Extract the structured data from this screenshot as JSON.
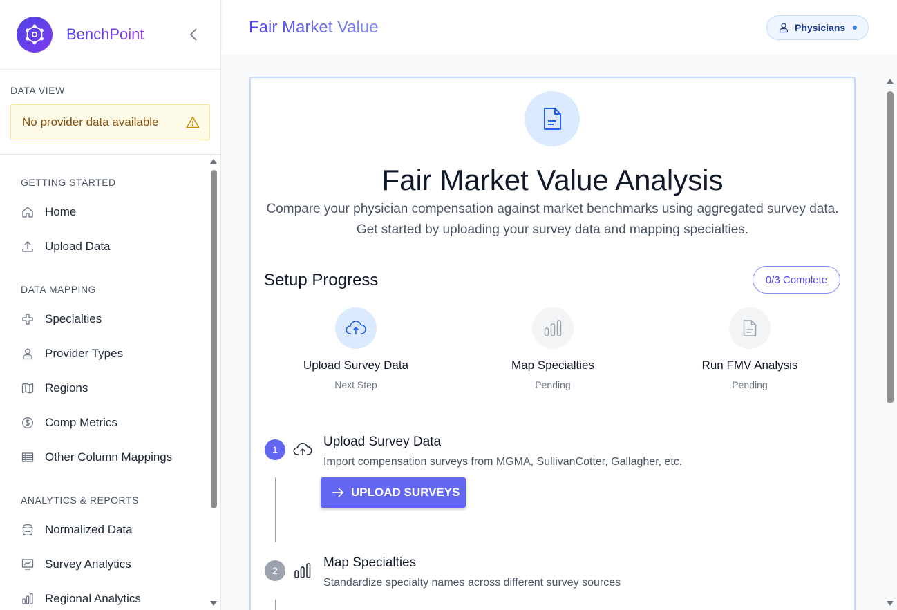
{
  "brand": {
    "name": "BenchPoint",
    "logo_icon": "atom-network-icon"
  },
  "data_view": {
    "label": "DATA VIEW",
    "warning": "No provider data available"
  },
  "nav": {
    "groups": [
      {
        "label": "GETTING STARTED"
      },
      {
        "label": "DATA MAPPING"
      },
      {
        "label": "ANALYTICS & REPORTS"
      }
    ],
    "items": [
      {
        "label": "Home",
        "icon": "home-icon"
      },
      {
        "label": "Upload Data",
        "icon": "upload-icon"
      },
      {
        "label": "Specialties",
        "icon": "medical-cross-icon"
      },
      {
        "label": "Provider Types",
        "icon": "person-icon"
      },
      {
        "label": "Regions",
        "icon": "map-icon"
      },
      {
        "label": "Comp Metrics",
        "icon": "dollar-icon"
      },
      {
        "label": "Other Column Mappings",
        "icon": "table-icon"
      },
      {
        "label": "Normalized Data",
        "icon": "database-icon"
      },
      {
        "label": "Survey Analytics",
        "icon": "chart-trend-icon"
      },
      {
        "label": "Regional Analytics",
        "icon": "bar-chart-icon"
      }
    ]
  },
  "header": {
    "title": "Fair Market Value",
    "role": "Physicians"
  },
  "hero": {
    "title": "Fair Market Value Analysis",
    "subtitle": "Compare your physician compensation against market benchmarks using aggregated survey data. Get started by uploading your survey data and mapping specialties."
  },
  "setup": {
    "title": "Setup Progress",
    "progress": "0/3 Complete",
    "steps": [
      {
        "title": "Upload Survey Data",
        "status": "Next Step"
      },
      {
        "title": "Map Specialties",
        "status": "Pending"
      },
      {
        "title": "Run FMV Analysis",
        "status": "Pending"
      }
    ]
  },
  "timeline": [
    {
      "num": "1",
      "title": "Upload Survey Data",
      "desc": "Import compensation surveys from MGMA, SullivanCotter, Gallagher, etc.",
      "cta": "UPLOAD SURVEYS"
    },
    {
      "num": "2",
      "title": "Map Specialties",
      "desc": "Standardize specialty names across different survey sources"
    }
  ],
  "colors": {
    "accent": "#6366f1",
    "brand_purple": "#7c3aed",
    "warning_bg": "#fefce8",
    "active_step_bg": "#dbeafe"
  }
}
